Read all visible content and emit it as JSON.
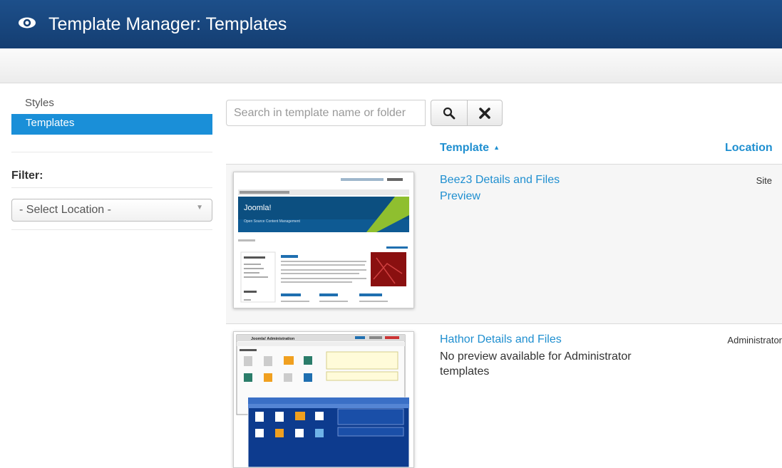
{
  "header": {
    "title": "Template Manager: Templates",
    "icon": "eye-icon"
  },
  "sidebar": {
    "items": [
      {
        "label": "Styles",
        "active": false
      },
      {
        "label": "Templates",
        "active": true
      }
    ],
    "filter_label": "Filter:",
    "location_select": {
      "value": "- Select Location -"
    }
  },
  "search": {
    "placeholder": "Search in template name or folder",
    "search_icon": "search-icon",
    "clear_icon": "close-icon"
  },
  "table": {
    "columns": {
      "template": "Template",
      "location": "Location"
    },
    "rows": [
      {
        "details_link": "Beez3 Details and Files",
        "preview": "Preview",
        "location": "Site",
        "thumb": {
          "site_name": "Joomla!",
          "tagline": "Open Source Content Management"
        }
      },
      {
        "details_link": "Hathor Details and Files",
        "preview": "No preview available for Administrator templates",
        "location": "Administrator",
        "thumb": {
          "site_name": "Joomla! Administration"
        }
      }
    ]
  },
  "colors": {
    "header": "#143e72",
    "accent": "#1a8fd8",
    "link": "#1f8fd0"
  }
}
